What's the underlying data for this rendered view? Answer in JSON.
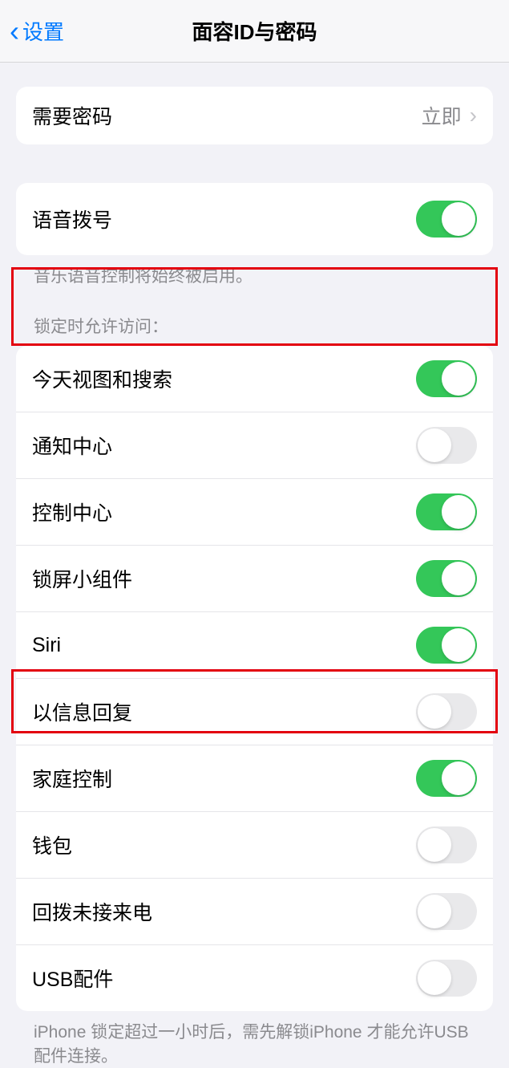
{
  "header": {
    "back_label": "设置",
    "title": "面容ID与密码"
  },
  "require_passcode": {
    "label": "需要密码",
    "value": "立即"
  },
  "voice_dial": {
    "label": "语音拨号",
    "enabled": true,
    "footer": "音乐语音控制将始终被启用。"
  },
  "lock_access": {
    "header": "锁定时允许访问：",
    "items": [
      {
        "label": "今天视图和搜索",
        "enabled": true
      },
      {
        "label": "通知中心",
        "enabled": false
      },
      {
        "label": "控制中心",
        "enabled": true
      },
      {
        "label": "锁屏小组件",
        "enabled": true
      },
      {
        "label": "Siri",
        "enabled": true
      },
      {
        "label": "以信息回复",
        "enabled": false
      },
      {
        "label": "家庭控制",
        "enabled": true
      },
      {
        "label": "钱包",
        "enabled": false
      },
      {
        "label": "回拨未接来电",
        "enabled": false
      },
      {
        "label": "USB配件",
        "enabled": false
      }
    ],
    "footer": "iPhone 锁定超过一小时后，需先解锁iPhone 才能允许USB 配件连接。"
  }
}
